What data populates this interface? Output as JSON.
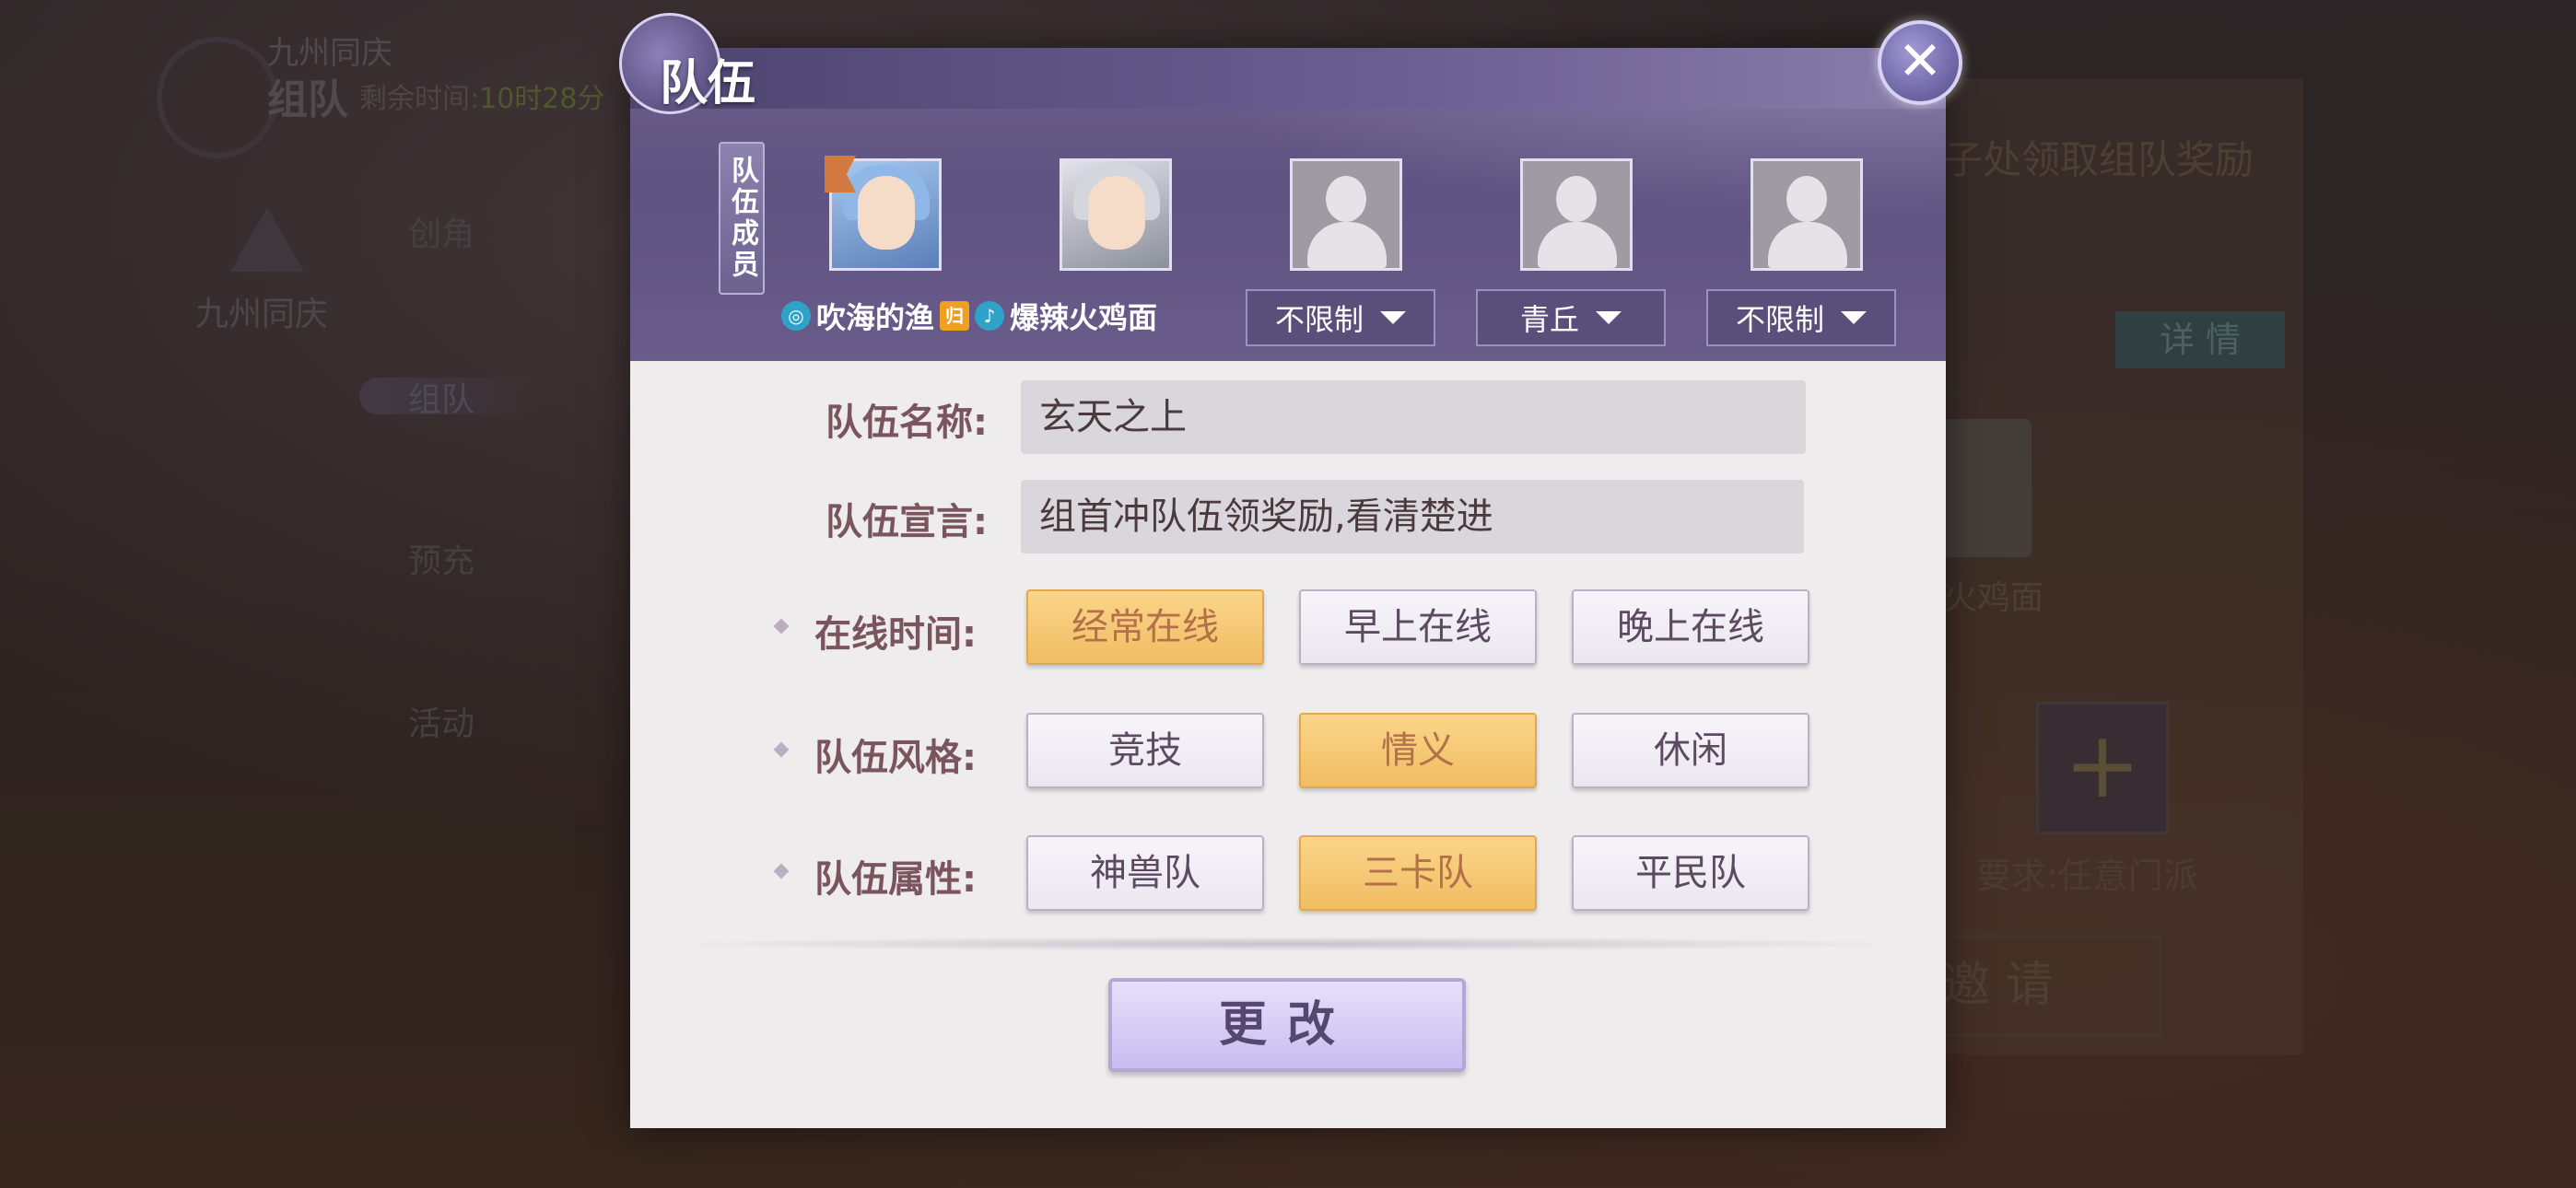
{
  "background": {
    "event_name": "九州同庆",
    "page_title": "组队",
    "remaining_label": "剩余时间:",
    "remaining_time": "10时28分",
    "side_event_name": "九州同庆",
    "menu": [
      "创角",
      "组队",
      "预充",
      "活动"
    ],
    "reward_text": "子处领取组队奖励",
    "detail_button": "详 情",
    "member_name": "火鸡面",
    "requirement": "要求:任意门派",
    "invite_button": "邀 请"
  },
  "dialog": {
    "title": "队伍",
    "members_tag": "队伍成员",
    "member1_name": "吹海的渔",
    "member1_tag": "归",
    "member2_name": "爆辣火鸡面",
    "slot_filters": [
      "不限制",
      "青丘",
      "不限制"
    ],
    "team_name_label": "队伍名称:",
    "team_name_value": "玄天之上",
    "team_declaration_label": "队伍宣言:",
    "team_declaration_value": "组首冲队伍领奖励,看清楚进",
    "online_time": {
      "label": "在线时间:",
      "options": [
        "经常在线",
        "早上在线",
        "晚上在线"
      ],
      "selected": "经常在线"
    },
    "team_style": {
      "label": "队伍风格:",
      "options": [
        "竞技",
        "情义",
        "休闲"
      ],
      "selected": "情义"
    },
    "team_attribute": {
      "label": "队伍属性:",
      "options": [
        "神兽队",
        "三卡队",
        "平民队"
      ],
      "selected": "三卡队"
    },
    "save_button": "更改"
  },
  "colors": {
    "header_purple": "#5f5381",
    "selected_gold": "#f0bd62",
    "label_text": "#7a5560"
  }
}
